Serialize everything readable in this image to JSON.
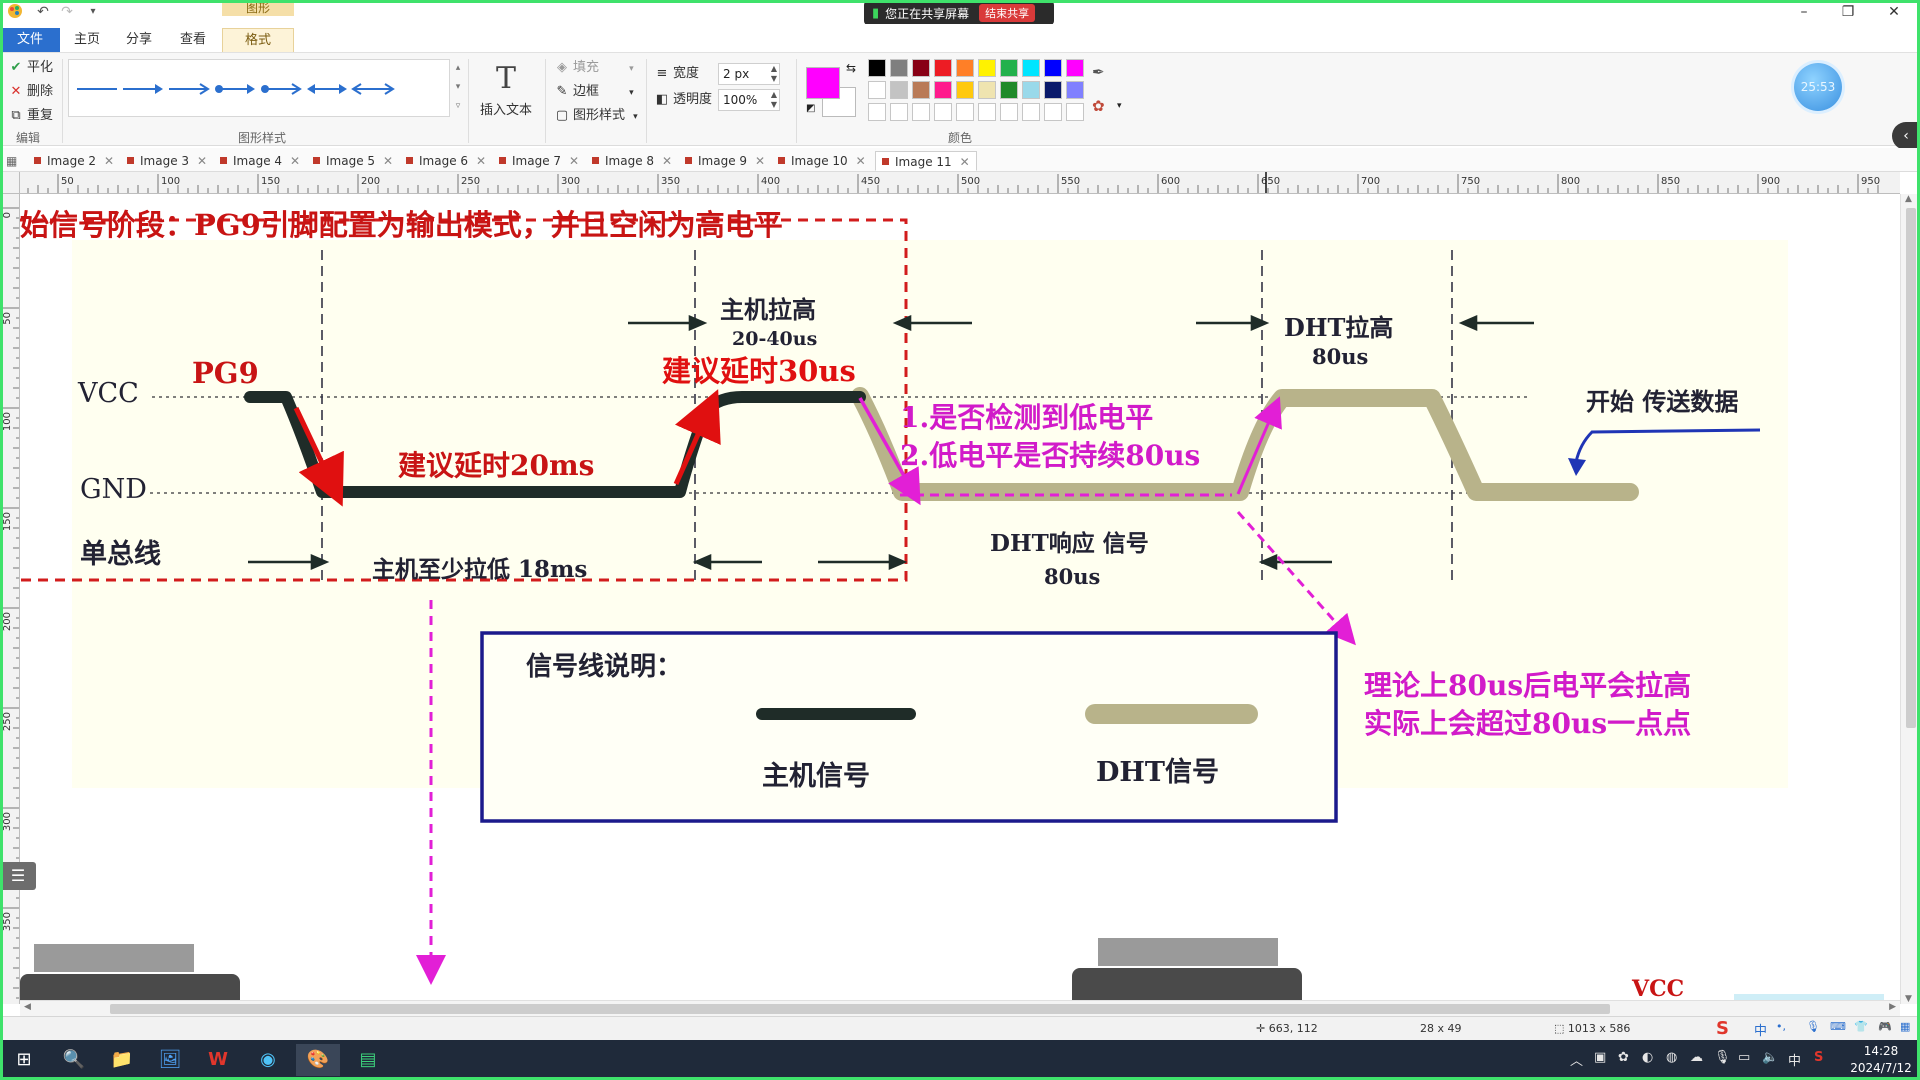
{
  "window": {
    "share_banner": "您正在共享屏幕",
    "share_stop": "结束共享"
  },
  "ribbon_tabs": {
    "context_label": "图形",
    "items": [
      "文件",
      "主页",
      "分享",
      "查看",
      "格式"
    ]
  },
  "ribbon": {
    "edit_group": {
      "label": "编辑",
      "smooth": "平化",
      "delete": "删除",
      "repeat": "重复"
    },
    "shape_style_group": {
      "label": "图形样式"
    },
    "insert_text": "插入文本",
    "fill": "填充",
    "border": "边框",
    "shape_style": "图形样式",
    "width_label": "宽度",
    "width_value": "2 px",
    "opacity_label": "透明度",
    "opacity_value": "100%",
    "color_group": {
      "label": "颜色"
    },
    "current_color": "#ff00ff",
    "palette": [
      [
        "#000000",
        "#7f7f7f",
        "#880015",
        "#ed1c24",
        "#ff7f27",
        "#fff200",
        "#22b14c",
        "#00e5ff",
        "#0000ff",
        "#ff00ff"
      ],
      [
        "#ffffff",
        "#c3c3c3",
        "#b97a57",
        "#ff1b8d",
        "#ffc90e",
        "#efe4b0",
        "#1f8a2a",
        "#99d9ea",
        "#0a1a6b",
        "#8080ff"
      ],
      [
        "#ffffff",
        "#ffffff",
        "#ffffff",
        "#ffffff",
        "#ffffff",
        "#ffffff",
        "#ffffff",
        "#ffffff",
        "#ffffff",
        "#ffffff"
      ]
    ],
    "user_timer": "25:53"
  },
  "doc_tabs": [
    "Image 2",
    "Image 3",
    "Image 4",
    "Image 5",
    "Image 6",
    "Image 7",
    "Image 8",
    "Image 9",
    "Image 10",
    "Image 11"
  ],
  "ruler": {
    "h_ticks": [
      50,
      100,
      150,
      200,
      250,
      300,
      350,
      400,
      450,
      500,
      550,
      600,
      650,
      700,
      750,
      800,
      850,
      900,
      950
    ],
    "v_ticks": [
      0,
      50,
      100,
      150,
      200,
      250,
      300,
      350
    ]
  },
  "diagram": {
    "title": "始信号阶段：PG9引脚配置为输出模式，并且空闲为高电平",
    "vcc": "VCC",
    "gnd": "GND",
    "bus": "单总线",
    "pg9": "PG9",
    "host_pull_high": "主机拉高",
    "host_pull_high_time": "20-40us",
    "suggest_30us": "建议延时30us",
    "suggest_20ms": "建议延时20ms",
    "host_pull_low": "主机至少拉低 18ms",
    "dht_pull_high": "DHT拉高",
    "dht_pull_high_time": "80us",
    "start_data": "开始 传送数据",
    "check_low": "1.是否检测到低电平",
    "check_80us": "2.低电平是否持续80us",
    "dht_response": "DHT响应 信号",
    "dht_response_time": "80us",
    "theory_line1": "理论上80us后电平会拉高",
    "theory_line2": "实际上会超过80us一点点",
    "legend_title": "信号线说明：",
    "legend_host": "主机信号",
    "legend_dht": "DHT信号",
    "bottom_vcc": "VCC"
  },
  "status": {
    "cursor": "663, 112",
    "selection": "28 x 49",
    "image_size": "1013 x 586"
  },
  "taskbar": {
    "time": "14:28",
    "date": "2024/7/12",
    "ime": "中",
    "lang": "中"
  }
}
